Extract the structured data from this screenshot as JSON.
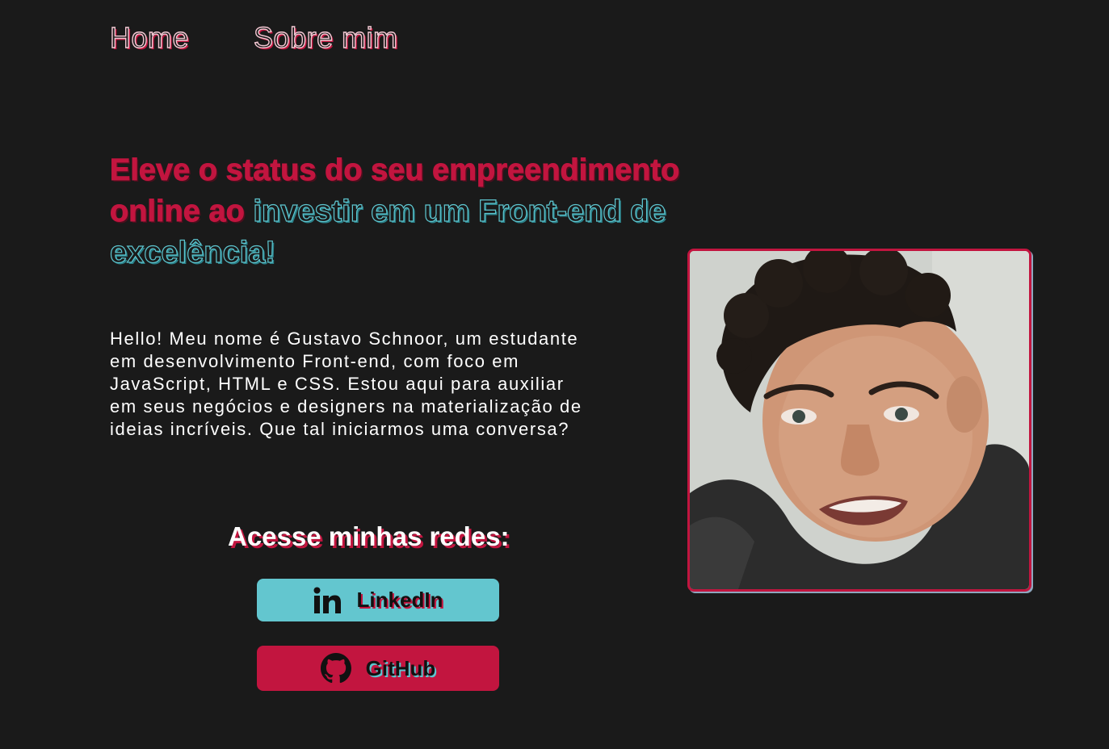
{
  "nav": {
    "home_label": "Home",
    "about_label": "Sobre mim"
  },
  "hero": {
    "headline_part1": "Eleve o status do seu empreendimento online ao",
    "headline_part2": "investir em um Front-end de excelência!",
    "intro": "Hello! Meu nome é Gustavo Schnoor, um estudante em desenvolvimento Front-end, com foco em JavaScript, HTML e CSS. Estou aqui para auxiliar em seus negócios e designers na materialização de ideias incríveis. Que tal iniciarmos uma conversa?"
  },
  "social": {
    "title": "Acesse minhas redes:",
    "linkedin_label": "LinkedIn",
    "github_label": "GitHub",
    "linkedin_icon": "linkedin-icon",
    "github_icon": "github-icon"
  },
  "photo": {
    "subject": "profile-photo"
  },
  "colors": {
    "background": "#1a1a1a",
    "accent_red": "#c2153f",
    "accent_teal": "#63c6cf",
    "text": "#ffffff"
  }
}
